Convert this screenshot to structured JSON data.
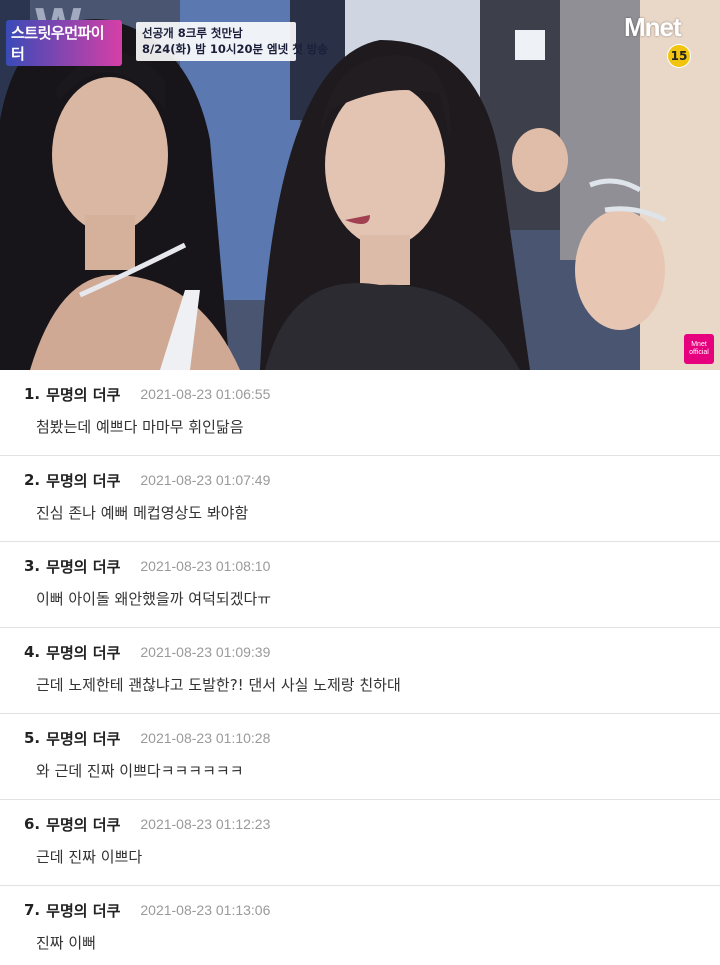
{
  "video": {
    "show_logo_text": "스트릿우먼파이터",
    "show_logo_mark": "W",
    "promo_lines": [
      "선공개 8크루 첫만남",
      "8/24(화) 밤 10시20분 엠넷 첫 방송"
    ],
    "channel_logo": "Mnet",
    "age_rating": "15",
    "channel_badge": [
      "Mnet",
      "official"
    ]
  },
  "comments": [
    {
      "num": "1.",
      "author": "무명의 더쿠",
      "time": "2021-08-23 01:06:55",
      "text": "첨봤는데 예쁘다 마마무 휘인닮음"
    },
    {
      "num": "2.",
      "author": "무명의 더쿠",
      "time": "2021-08-23 01:07:49",
      "text": "진심 존나 예뻐 메컵영상도 봐야함"
    },
    {
      "num": "3.",
      "author": "무명의 더쿠",
      "time": "2021-08-23 01:08:10",
      "text": "이뻐 아이돌 왜안했을까 여덕되겠다ㅠ"
    },
    {
      "num": "4.",
      "author": "무명의 더쿠",
      "time": "2021-08-23 01:09:39",
      "text": "근데 노제한테 괜찮냐고 도발한?! 댄서 사실 노제랑 친하대"
    },
    {
      "num": "5.",
      "author": "무명의 더쿠",
      "time": "2021-08-23 01:10:28",
      "text": "와 근데 진짜 이쁘다ㅋㅋㅋㅋㅋㅋ"
    },
    {
      "num": "6.",
      "author": "무명의 더쿠",
      "time": "2021-08-23 01:12:23",
      "text": "근데 진짜 이쁘다"
    },
    {
      "num": "7.",
      "author": "무명의 더쿠",
      "time": "2021-08-23 01:13:06",
      "text": "진짜 이뻐"
    }
  ]
}
